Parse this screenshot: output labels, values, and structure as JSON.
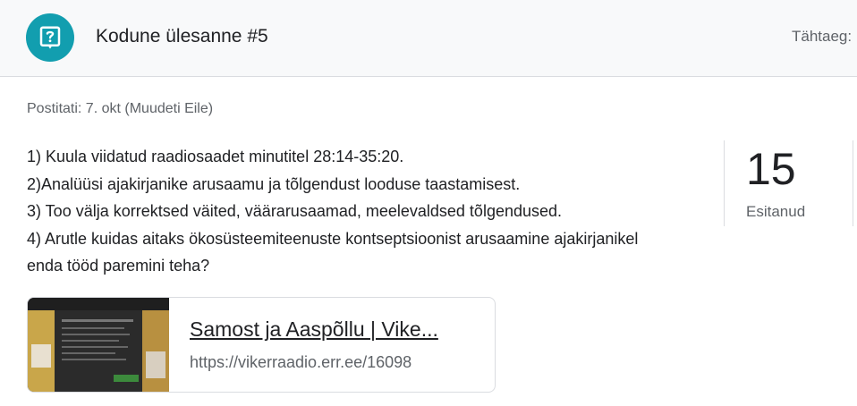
{
  "header": {
    "title": "Kodune ülesanne #5",
    "due_label": "Tähtaeg:",
    "icon": "assignment-question-icon",
    "accent_color": "#129eaf"
  },
  "posted": "Postitati: 7. okt (Muudeti Eile)",
  "instructions": [
    "1) Kuula viidatud raadiosaadet minutitel 28:14-35:20.",
    "2)Analüüsi ajakirjanike arusaamu ja tõlgendust looduse taastamisest.",
    "3) Too välja korrektsed väited, väärarusaamad, meelevaldsed tõlgendused.",
    "4) Arutle kuidas aitaks ökosüsteemiteenuste kontseptsioonist arusaamine ajakirjanikel",
    "enda tööd paremini teha?"
  ],
  "stats": {
    "submitted_count": "15",
    "submitted_label": "Esitanud"
  },
  "attachment": {
    "title": "Samost ja Aaspõllu | Vike...",
    "url": "https://vikerraadio.err.ee/16098"
  }
}
